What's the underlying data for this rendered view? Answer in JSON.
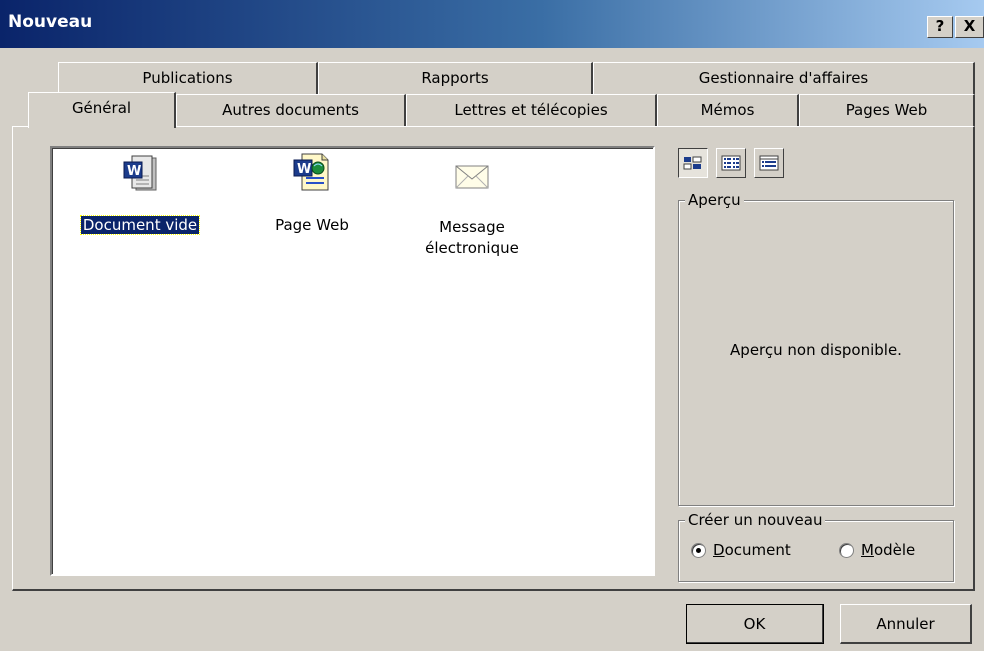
{
  "window": {
    "title": "Nouveau",
    "help_label": "?",
    "close_label": "X"
  },
  "tabs_back": [
    "Publications",
    "Rapports",
    "Gestionnaire d'affaires"
  ],
  "tabs_front": [
    "Général",
    "Autres documents",
    "Lettres et télécopies",
    "Mémos",
    "Pages Web"
  ],
  "active_tab": "Général",
  "templates": [
    {
      "label": "Document vide",
      "icon": "word-document-icon",
      "selected": true
    },
    {
      "label": "Page Web",
      "icon": "word-web-page-icon",
      "selected": false
    },
    {
      "label_line1": "Message",
      "label_line2": "électronique",
      "icon": "email-envelope-icon",
      "selected": false
    }
  ],
  "view_buttons": [
    "large-icons",
    "list",
    "details"
  ],
  "preview": {
    "legend": "Aperçu",
    "message": "Aperçu non disponible."
  },
  "create_new": {
    "legend": "Créer un nouveau",
    "option_document": {
      "first": "D",
      "rest": "ocument",
      "selected": true
    },
    "option_template": {
      "first": "M",
      "rest": "odèle",
      "selected": false
    }
  },
  "buttons": {
    "ok": "OK",
    "cancel": "Annuler"
  },
  "colors": {
    "title_start": "#0a246a",
    "title_end": "#a6caf0",
    "face": "#d4d0c8",
    "selection": "#0a246a"
  }
}
